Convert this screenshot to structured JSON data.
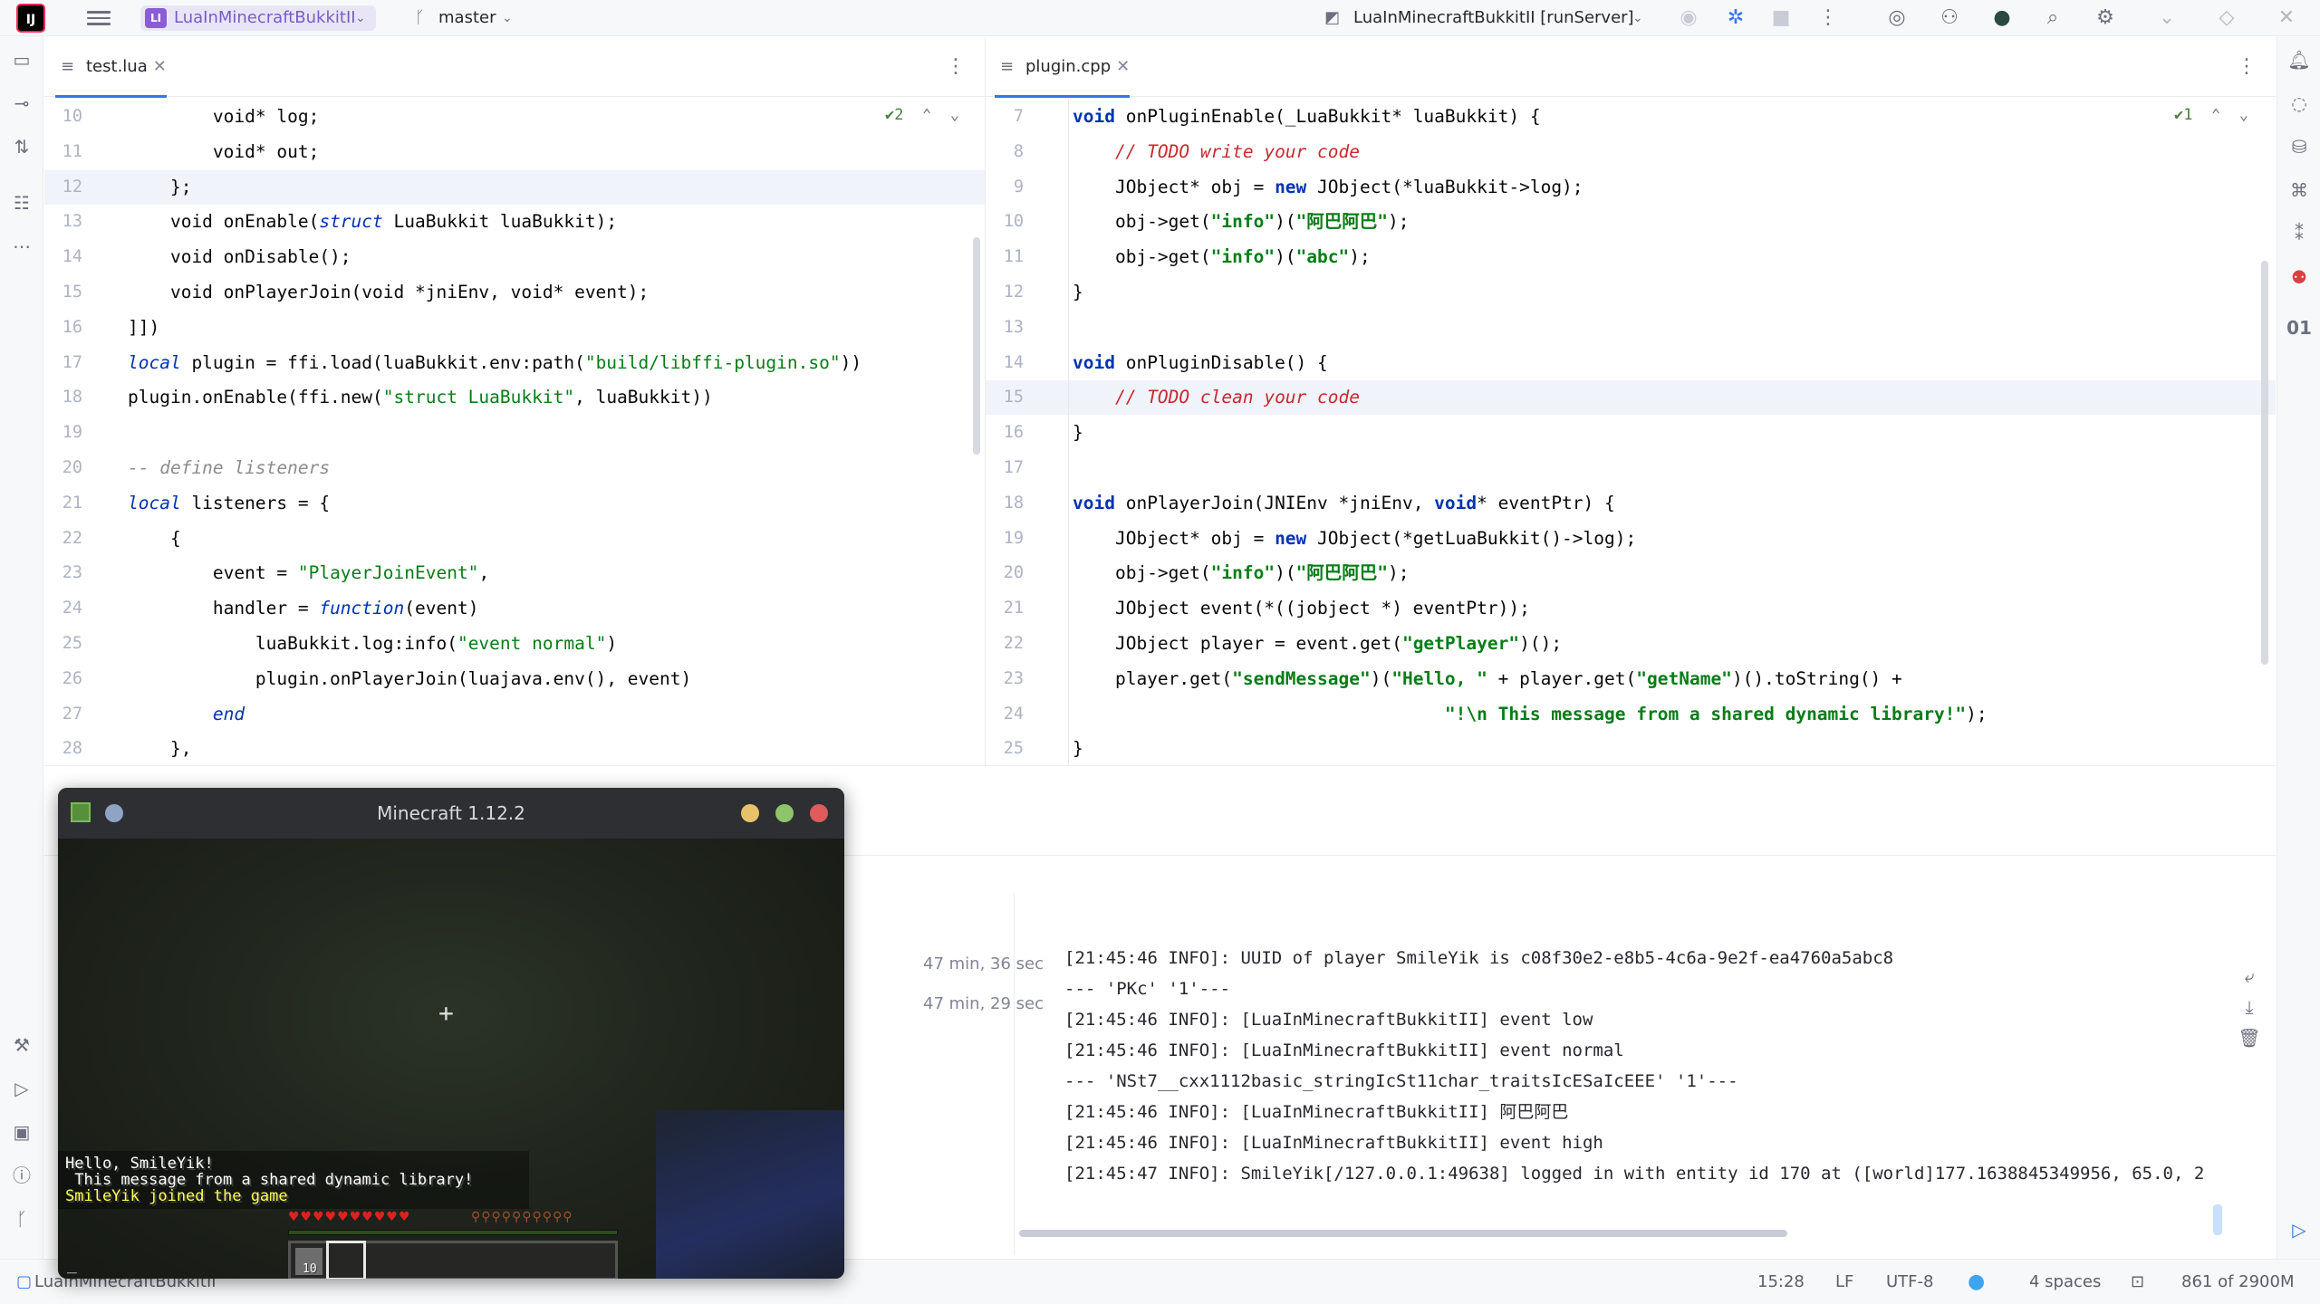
{
  "titlebar": {
    "ide_logo": "IJ",
    "project_badge": "LI",
    "project_name": "LuaInMinecraftBukkitII",
    "branch": "master",
    "run_config": "LuaInMinecraftBukkitII [runServer]",
    "colors": {
      "accent": "#3574f0",
      "project_badge": "#8a5cd6"
    }
  },
  "left_editor": {
    "tab_label": "test.lua",
    "inspections_count": "2",
    "lines": [
      {
        "n": "10",
        "text": "        void* log;"
      },
      {
        "n": "11",
        "text": "        void* out;"
      },
      {
        "n": "12",
        "text": "    };"
      },
      {
        "n": "13",
        "text": "    void onEnable(struct LuaBukkit luaBukkit);"
      },
      {
        "n": "14",
        "text": "    void onDisable();"
      },
      {
        "n": "15",
        "text": "    void onPlayerJoin(void *jniEnv, void* event);"
      },
      {
        "n": "16",
        "text": "]])"
      },
      {
        "n": "17",
        "text": "local plugin = ffi.load(luaBukkit.env:path(\"build/libffi-plugin.so\"))"
      },
      {
        "n": "18",
        "text": "plugin.onEnable(ffi.new(\"struct LuaBukkit\", luaBukkit))"
      },
      {
        "n": "19",
        "text": ""
      },
      {
        "n": "20",
        "text": "-- define listeners"
      },
      {
        "n": "21",
        "text": "local listeners = {"
      },
      {
        "n": "22",
        "text": "    {"
      },
      {
        "n": "23",
        "text": "        event = \"PlayerJoinEvent\","
      },
      {
        "n": "24",
        "text": "        handler = function(event)"
      },
      {
        "n": "25",
        "text": "            luaBukkit.log:info(\"event normal\")"
      },
      {
        "n": "26",
        "text": "            plugin.onPlayerJoin(luajava.env(), event)"
      },
      {
        "n": "27",
        "text": "        end"
      },
      {
        "n": "28",
        "text": "    },"
      }
    ]
  },
  "right_editor": {
    "tab_label": "plugin.cpp",
    "inspections_count": "1",
    "lines": [
      {
        "n": "7",
        "text": "void onPluginEnable(_LuaBukkit* luaBukkit) {"
      },
      {
        "n": "8",
        "text": "    // TODO write your code"
      },
      {
        "n": "9",
        "text": "    JObject* obj = new JObject(*luaBukkit->log);"
      },
      {
        "n": "10",
        "text": "    obj->get(\"info\")(\"阿巴阿巴\");"
      },
      {
        "n": "11",
        "text": "    obj->get(\"info\")(\"abc\");"
      },
      {
        "n": "12",
        "text": "}"
      },
      {
        "n": "13",
        "text": ""
      },
      {
        "n": "14",
        "text": "void onPluginDisable() {"
      },
      {
        "n": "15",
        "text": "    // TODO clean your code"
      },
      {
        "n": "16",
        "text": "}"
      },
      {
        "n": "17",
        "text": ""
      },
      {
        "n": "18",
        "text": "void onPlayerJoin(JNIEnv *jniEnv, void* eventPtr) {"
      },
      {
        "n": "19",
        "text": "    JObject* obj = new JObject(*getLuaBukkit()->log);"
      },
      {
        "n": "20",
        "text": "    obj->get(\"info\")(\"阿巴阿巴\");"
      },
      {
        "n": "21",
        "text": "    JObject event(*((jobject *) eventPtr));"
      },
      {
        "n": "22",
        "text": "    JObject player = event.get(\"getPlayer\")();"
      },
      {
        "n": "23",
        "text": "    player.get(\"sendMessage\")(\"Hello, \" + player.get(\"getName\")().toString() +"
      },
      {
        "n": "24",
        "text": "                                   \"!\\n This message from a shared dynamic library!\");"
      },
      {
        "n": "25",
        "text": "}"
      }
    ]
  },
  "run_panel": {
    "times": [
      "47 min, 36 sec",
      "47 min, 29 sec"
    ],
    "console": [
      "[21:45:46 INFO]: UUID of player SmileYik is c08f30e2-e8b5-4c6a-9e2f-ea4760a5abc8",
      "--- 'PKc' '1'---",
      "[21:45:46 INFO]: [LuaInMinecraftBukkitII] event low",
      "[21:45:46 INFO]: [LuaInMinecraftBukkitII] event normal",
      "--- 'NSt7__cxx1112basic_stringIcSt11char_traitsIcESaIcEEE' '1'---",
      "[21:45:46 INFO]: [LuaInMinecraftBukkitII] 阿巴阿巴",
      "[21:45:46 INFO]: [LuaInMinecraftBukkitII] event high",
      "[21:45:47 INFO]: SmileYik[/127.0.0.1:49638] logged in with entity id 170 at ([world]177.1638845349956, 65.0, 2"
    ]
  },
  "minecraft": {
    "title": "Minecraft 1.12.2",
    "chat": [
      "Hello, SmileYik!",
      " This message from a shared dynamic library!",
      "SmileYik joined the game"
    ],
    "hotbar_count": "10",
    "crosshair": "+",
    "cursor": "_"
  },
  "statusbar": {
    "project": "LuaInMinecraftBukkitII",
    "cursor_pos": "15:28",
    "line_sep": "LF",
    "encoding": "UTF-8",
    "indent": "4 spaces",
    "memory": "861 of 2900M"
  }
}
